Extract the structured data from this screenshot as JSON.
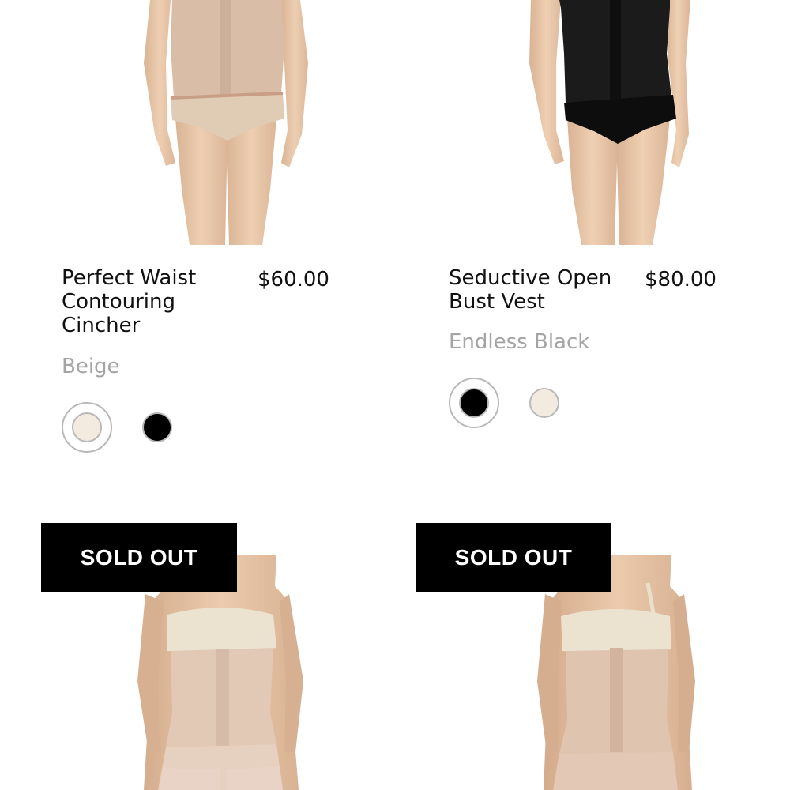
{
  "colors": {
    "beige_swatch": "#f4ebe0",
    "black_swatch": "#000000",
    "badge_bg": "#000000",
    "color_name_text": "#a4a4a4"
  },
  "products": [
    {
      "title": "Perfect Waist Contouring Cincher",
      "price": "$60.00",
      "selected_color": "Beige",
      "swatches": [
        "Beige",
        "Black"
      ]
    },
    {
      "title": "Seductive Open Bust Vest",
      "price": "$80.00",
      "selected_color": "Endless Black",
      "swatches": [
        "Endless Black",
        "Beige"
      ]
    },
    {
      "badge": "SOLD OUT"
    },
    {
      "badge": "SOLD OUT"
    }
  ]
}
